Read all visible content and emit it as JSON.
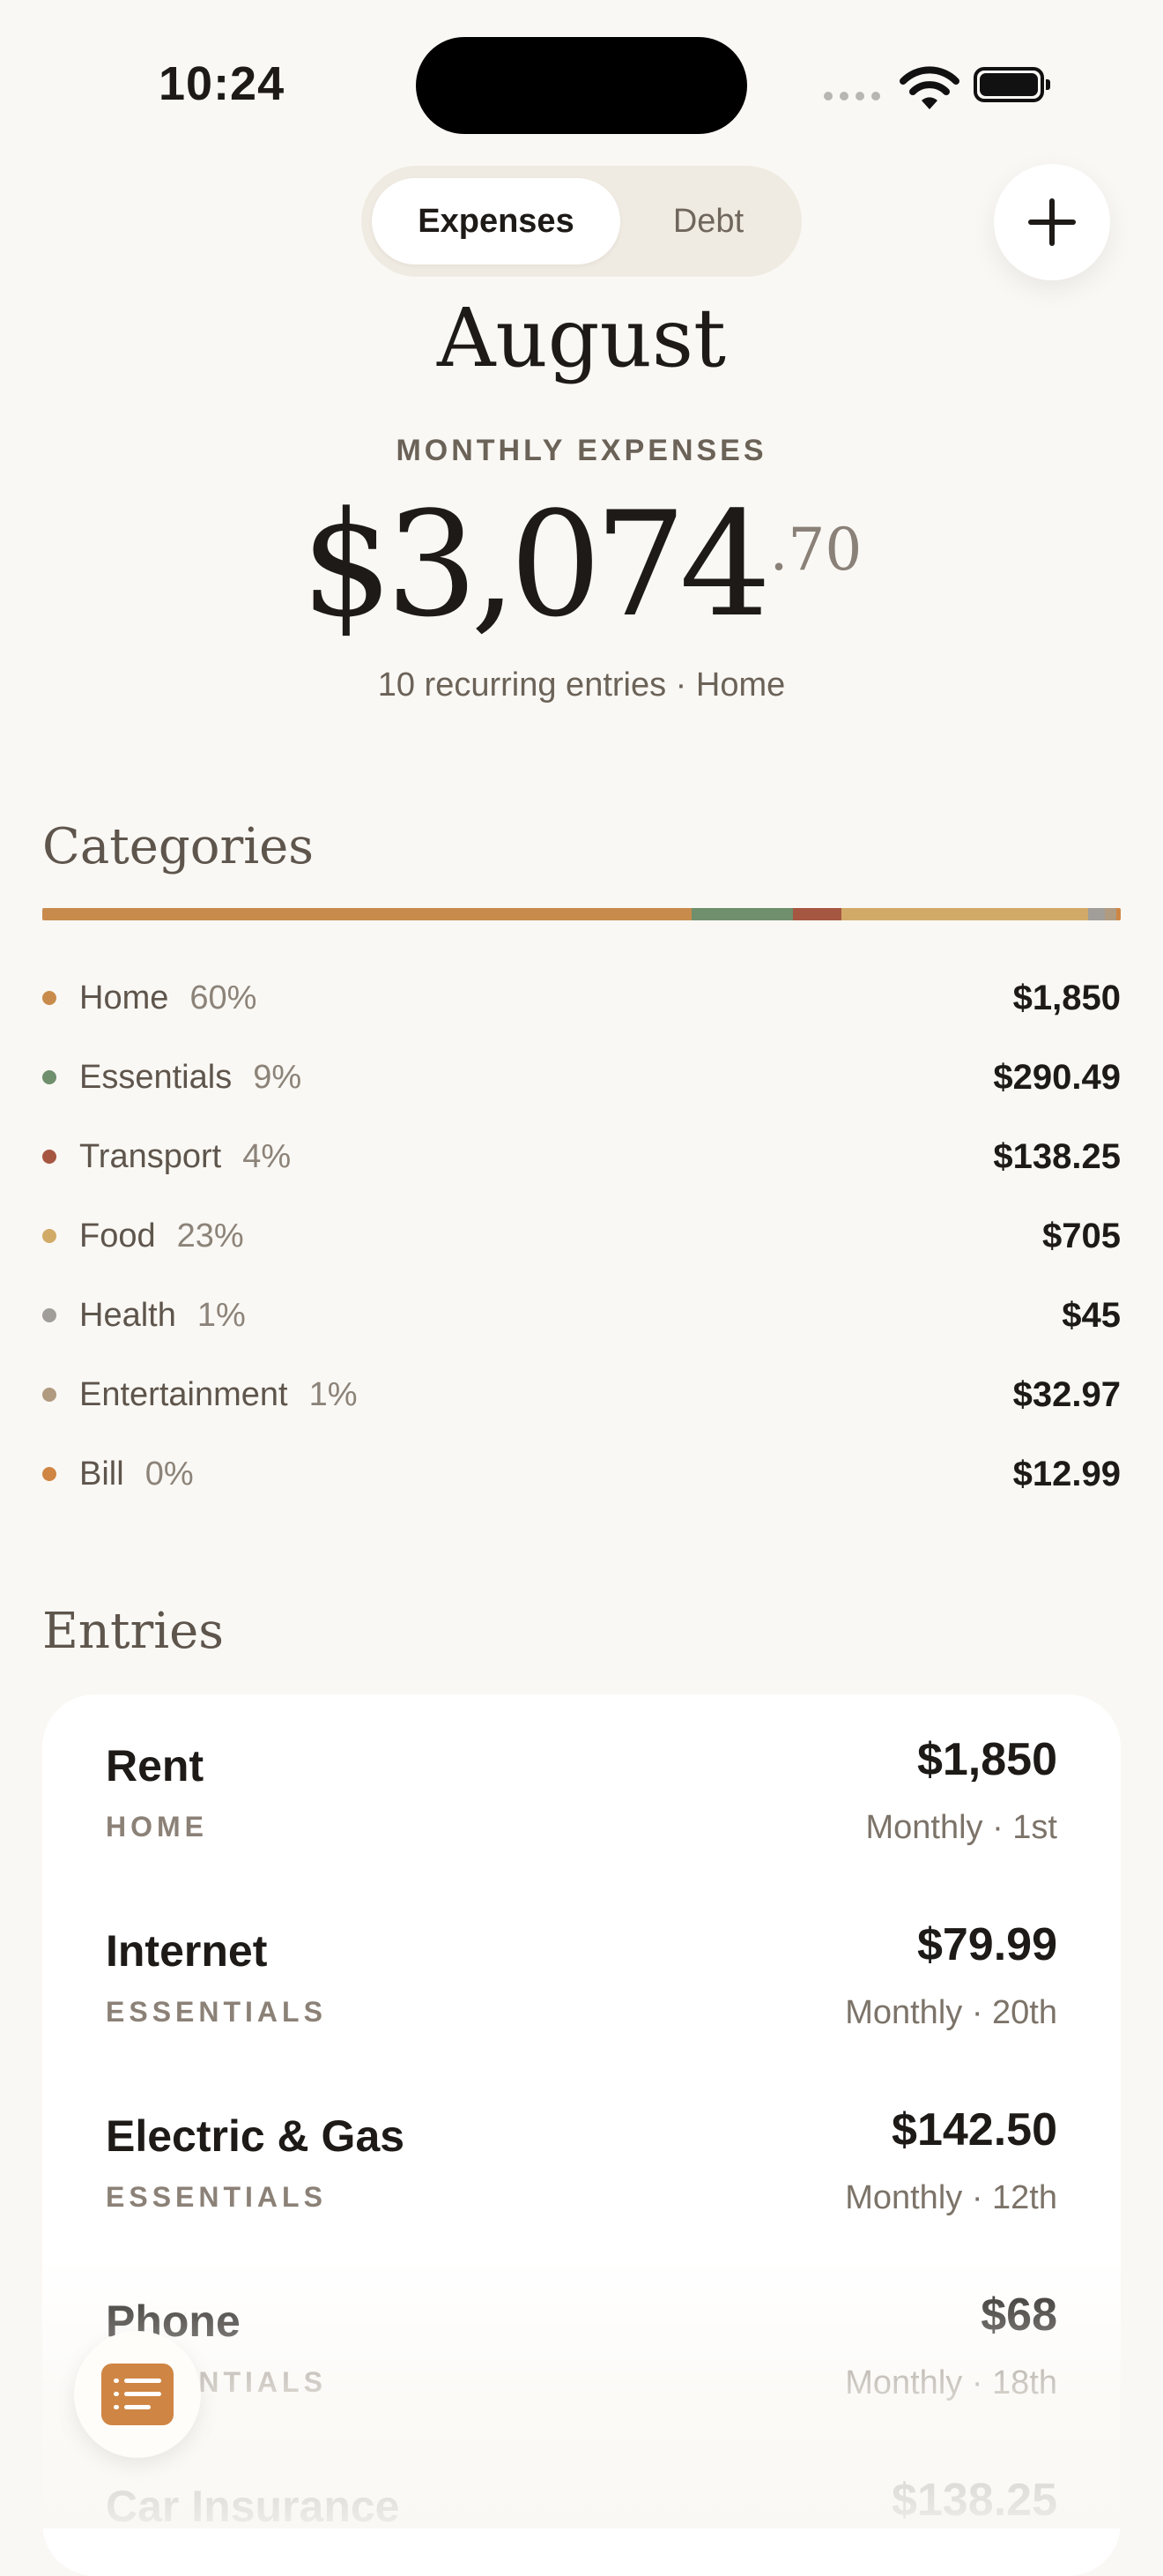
{
  "status": {
    "time": "10:24"
  },
  "segmented": {
    "expenses_label": "Expenses",
    "debt_label": "Debt"
  },
  "hero": {
    "month": "August",
    "label": "MONTHLY EXPENSES",
    "amount_main": "$3,074",
    "amount_cents": ".70",
    "subtitle": "10 recurring entries · Home"
  },
  "categories": {
    "title": "Categories",
    "items": [
      {
        "name": "Home",
        "percent": "60%",
        "amount": "$1,850",
        "color": "#c98b4c",
        "share": 60.2
      },
      {
        "name": "Essentials",
        "percent": "9%",
        "amount": "$290.49",
        "color": "#6f8f6d",
        "share": 9.4
      },
      {
        "name": "Transport",
        "percent": "4%",
        "amount": "$138.25",
        "color": "#a65741",
        "share": 4.5
      },
      {
        "name": "Food",
        "percent": "23%",
        "amount": "$705",
        "color": "#d2aa68",
        "share": 22.9
      },
      {
        "name": "Health",
        "percent": "1%",
        "amount": "$45",
        "color": "#a19e99",
        "share": 1.5
      },
      {
        "name": "Entertainment",
        "percent": "1%",
        "amount": "$32.97",
        "color": "#b09a80",
        "share": 1.1
      },
      {
        "name": "Bill",
        "percent": "0%",
        "amount": "$12.99",
        "color": "#cf8644",
        "share": 0.4
      }
    ]
  },
  "entries": {
    "title": "Entries",
    "items": [
      {
        "name": "Rent",
        "category": "HOME",
        "amount": "$1,850",
        "schedule": "Monthly · 1st"
      },
      {
        "name": "Internet",
        "category": "ESSENTIALS",
        "amount": "$79.99",
        "schedule": "Monthly · 20th"
      },
      {
        "name": "Electric & Gas",
        "category": "ESSENTIALS",
        "amount": "$142.50",
        "schedule": "Monthly · 12th"
      },
      {
        "name": "Phone",
        "category": "ESSENTIALS",
        "amount": "$68",
        "schedule": "Monthly · 18th"
      },
      {
        "name": "Car Insurance",
        "category": "",
        "amount": "$138.25",
        "schedule": ""
      }
    ]
  },
  "icons": {
    "add": "plus-icon",
    "list": "list-icon",
    "wifi": "wifi-icon",
    "battery": "battery-icon"
  }
}
